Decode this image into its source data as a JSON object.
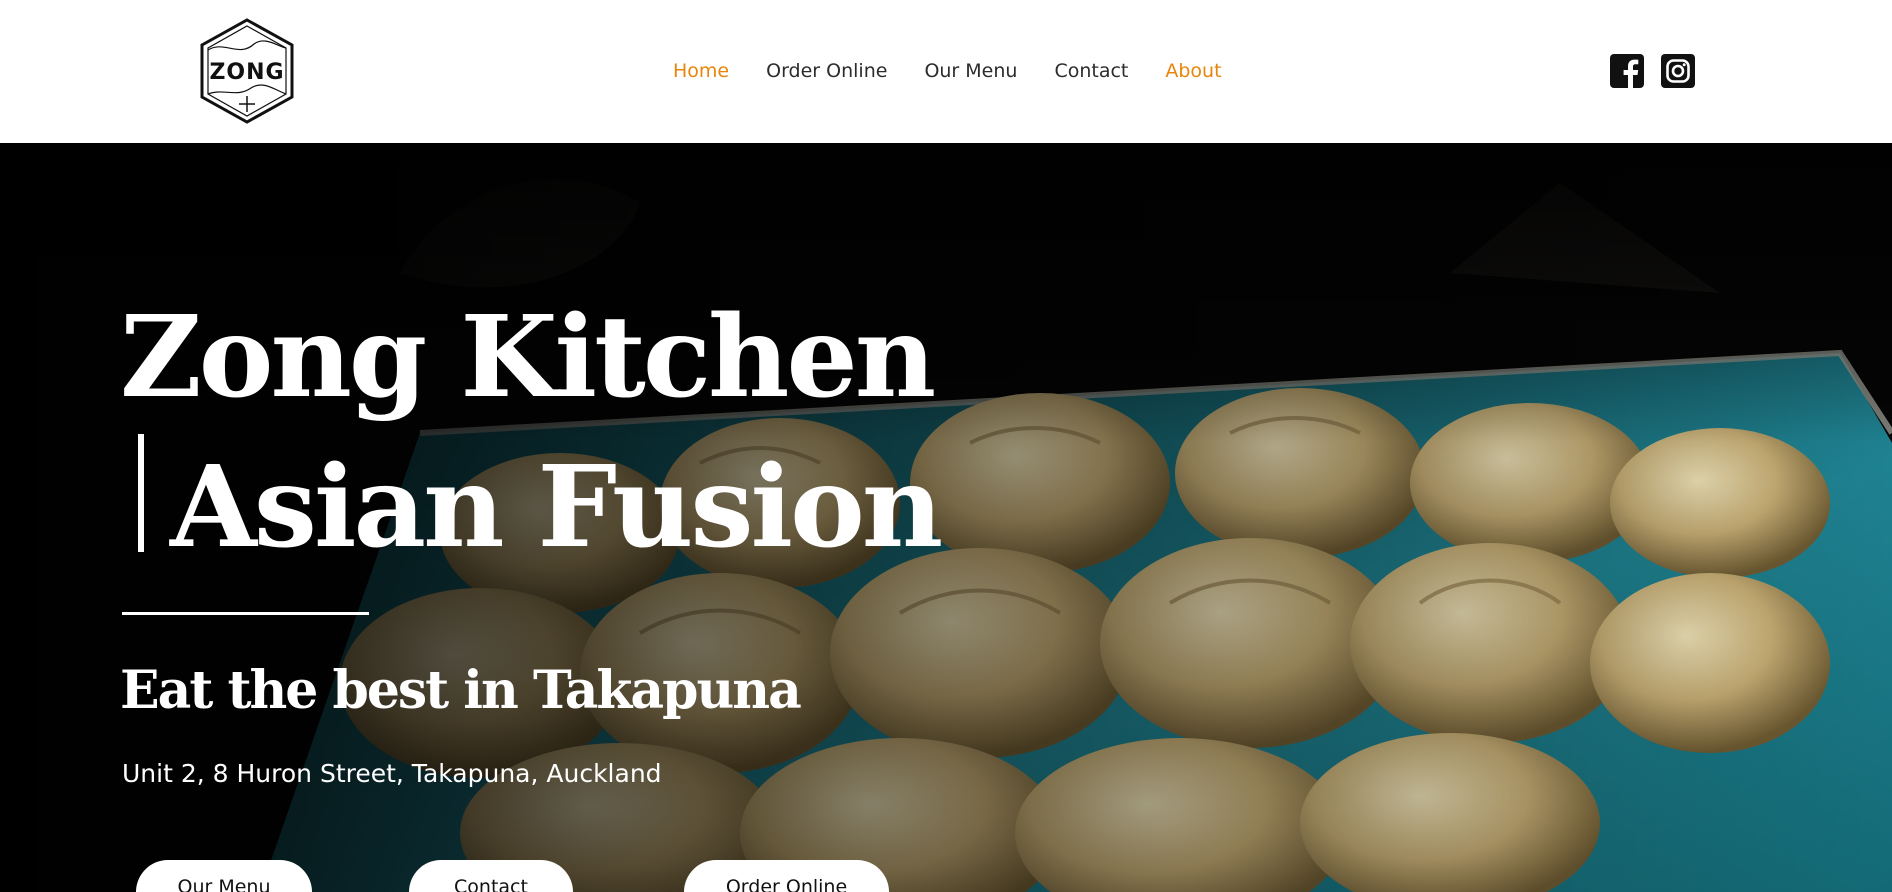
{
  "header": {
    "logo_text": "ZONG",
    "nav": [
      {
        "label": "Home",
        "active": true
      },
      {
        "label": "Order Online",
        "active": false
      },
      {
        "label": "Our Menu",
        "active": false
      },
      {
        "label": "Contact",
        "active": false
      },
      {
        "label": "About",
        "active": true
      }
    ],
    "social": [
      {
        "name": "facebook-icon"
      },
      {
        "name": "instagram-icon"
      }
    ]
  },
  "hero": {
    "title_line1": "Zong Kitchen",
    "title_line2": "Asian Fusion",
    "tagline": "Eat the best in Takapuna",
    "address": "Unit 2, 8 Huron Street, Takapuna, Auckland",
    "buttons": [
      {
        "label": "Our Menu"
      },
      {
        "label": "Contact"
      },
      {
        "label": "Order Online"
      }
    ]
  },
  "colors": {
    "accent": "#e8860c",
    "nav_text": "#2c2c2c",
    "hero_bg": "#050505",
    "plate": "#1d7f8c",
    "dumpling": "#c8b27c"
  }
}
